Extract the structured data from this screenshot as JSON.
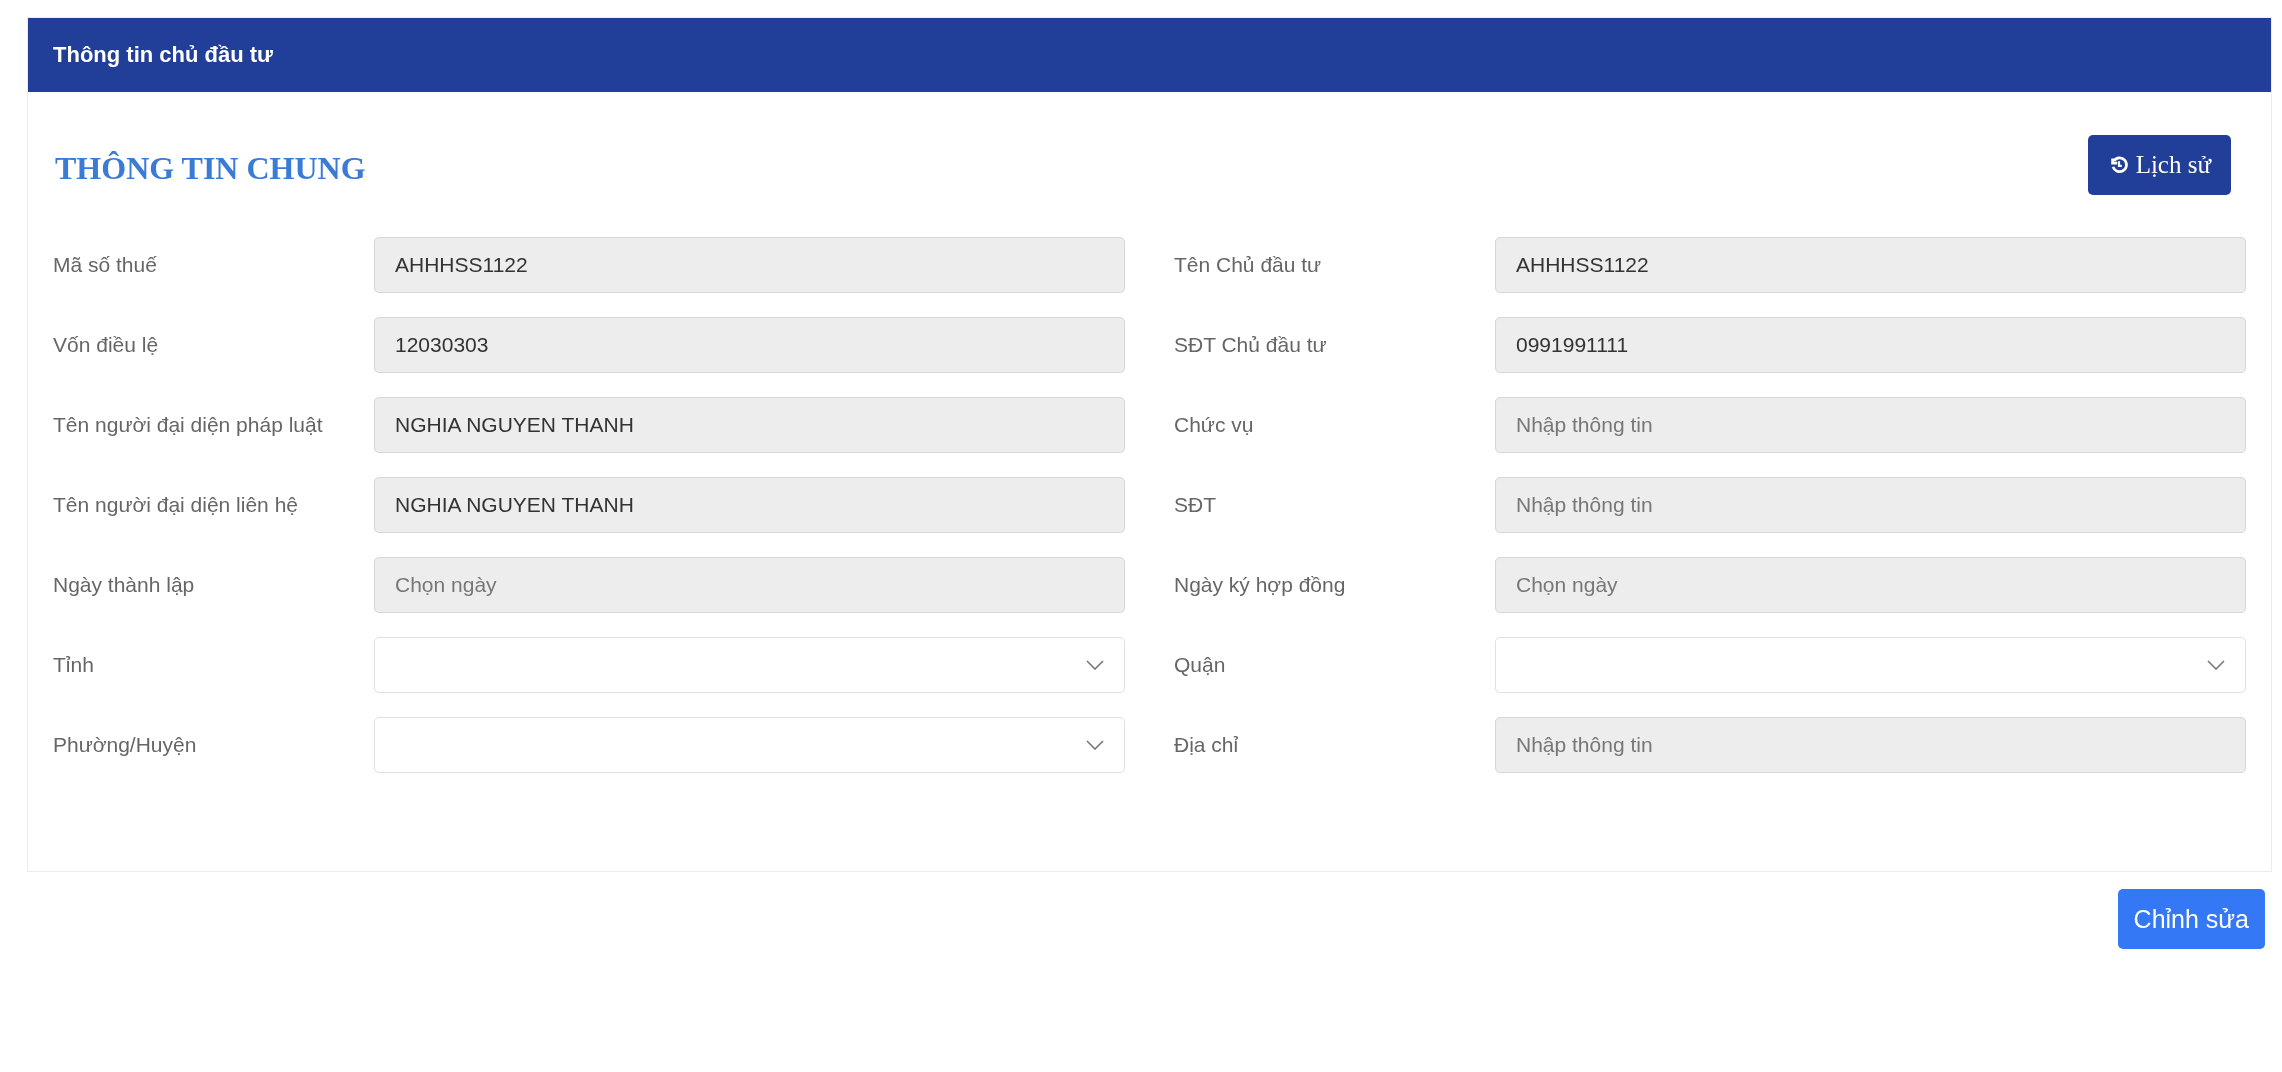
{
  "panel": {
    "title": "Thông tin chủ đầu tư"
  },
  "section_title": "THÔNG TIN CHUNG",
  "history_button": {
    "label": "Lịch sử"
  },
  "fields": [
    {
      "label": "Mã số thuế",
      "kind": "text",
      "disabled": true,
      "value": "AHHHSS1122"
    },
    {
      "label": "Tên Chủ đầu tư",
      "kind": "text",
      "disabled": true,
      "value": "AHHHSS1122"
    },
    {
      "label": "Vốn điều lệ",
      "kind": "text",
      "disabled": true,
      "value": "12030303"
    },
    {
      "label": "SĐT Chủ đầu tư",
      "kind": "text",
      "disabled": true,
      "value": "0991991111"
    },
    {
      "label": "Tên người đại diện pháp luật",
      "kind": "text",
      "disabled": true,
      "value": "NGHIA NGUYEN THANH"
    },
    {
      "label": "Chức vụ",
      "kind": "text",
      "disabled": true,
      "placeholder": "Nhập thông tin"
    },
    {
      "label": "Tên người đại diện liên hệ",
      "kind": "text",
      "disabled": true,
      "value": "NGHIA NGUYEN THANH"
    },
    {
      "label": "SĐT",
      "kind": "text",
      "disabled": true,
      "placeholder": "Nhập thông tin"
    },
    {
      "label": "Ngày thành lập",
      "kind": "date",
      "disabled": true,
      "placeholder": "Chọn ngày"
    },
    {
      "label": "Ngày ký hợp đồng",
      "kind": "date",
      "disabled": true,
      "placeholder": "Chọn ngày"
    },
    {
      "label": "Tỉnh",
      "kind": "select",
      "disabled": false
    },
    {
      "label": "Quận",
      "kind": "select",
      "disabled": false
    },
    {
      "label": "Phường/Huyện",
      "kind": "select",
      "disabled": false
    },
    {
      "label": "Địa chỉ",
      "kind": "text",
      "disabled": true,
      "placeholder": "Nhập thông tin"
    }
  ],
  "edit_button": {
    "label": "Chỉnh sửa"
  }
}
